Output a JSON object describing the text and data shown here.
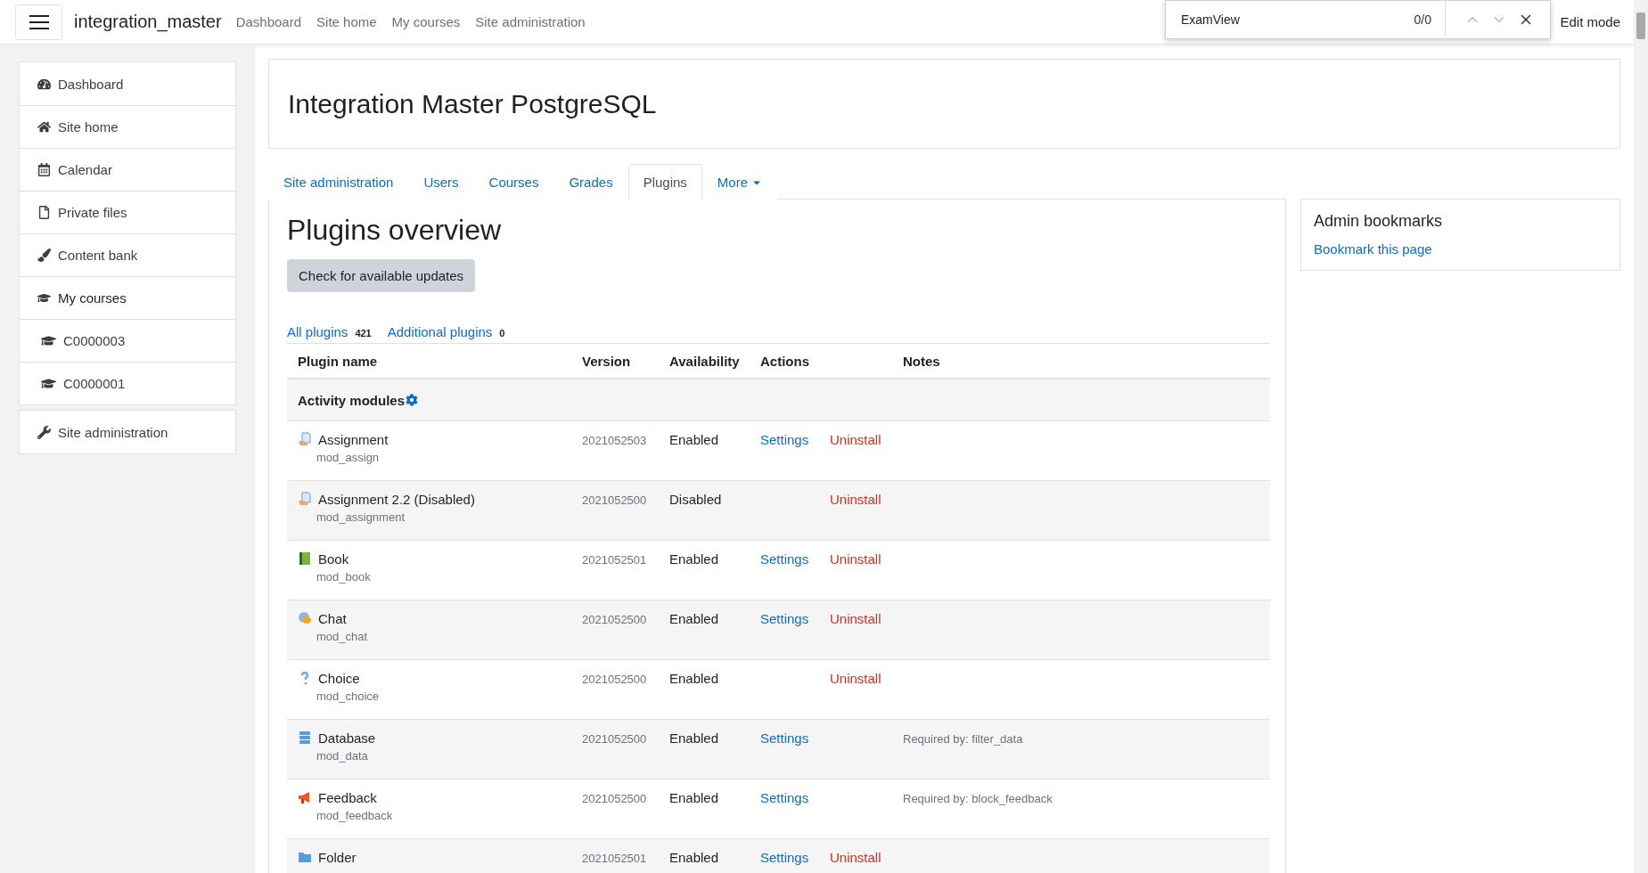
{
  "navbar": {
    "brand": "integration_master",
    "links": [
      "Dashboard",
      "Site home",
      "My courses",
      "Site administration"
    ],
    "edit_mode": "Edit mode"
  },
  "find_bar": {
    "value": "ExamView",
    "count": "0/0"
  },
  "sidebar": {
    "sections": [
      {
        "items": [
          {
            "label": "Dashboard"
          },
          {
            "label": "Site home"
          },
          {
            "label": "Calendar"
          },
          {
            "label": "Private files"
          },
          {
            "label": "Content bank"
          },
          {
            "label": "My courses",
            "children": [
              {
                "label": "C0000003"
              },
              {
                "label": "C0000001"
              }
            ]
          }
        ]
      },
      {
        "items": [
          {
            "label": "Site administration"
          }
        ]
      }
    ]
  },
  "header": {
    "title": "Integration Master PostgreSQL"
  },
  "tabs": [
    {
      "label": "Site administration",
      "selected": false,
      "kind": "link"
    },
    {
      "label": "Users",
      "selected": false,
      "kind": "link"
    },
    {
      "label": "Courses",
      "selected": false,
      "kind": "link"
    },
    {
      "label": "Grades",
      "selected": false,
      "kind": "link"
    },
    {
      "label": "Plugins",
      "selected": true,
      "kind": "link"
    },
    {
      "label": "More",
      "selected": false,
      "kind": "dropdown"
    }
  ],
  "content": {
    "title": "Plugins overview",
    "button": "Check for available updates",
    "filters": [
      {
        "label": "All plugins",
        "count": "421"
      },
      {
        "label": "Additional plugins",
        "count": "0"
      }
    ]
  },
  "table": {
    "columns": [
      "Plugin name",
      "Version",
      "Availability",
      "Actions",
      "Notes"
    ],
    "group": "Activity modules",
    "rows": [
      {
        "kind": "assign",
        "name": "Assignment",
        "module": "mod_assign",
        "version": "2021052503",
        "availability": "Enabled",
        "settings": "Settings",
        "uninstall": "Uninstall"
      },
      {
        "kind": "assign",
        "name": "Assignment 2.2 (Disabled)",
        "module": "mod_assignment",
        "version": "2021052500",
        "availability": "Disabled",
        "uninstall": "Uninstall"
      },
      {
        "kind": "book",
        "name": "Book",
        "module": "mod_book",
        "version": "2021052501",
        "availability": "Enabled",
        "settings": "Settings",
        "uninstall": "Uninstall"
      },
      {
        "kind": "chat",
        "name": "Chat",
        "module": "mod_chat",
        "version": "2021052500",
        "availability": "Enabled",
        "settings": "Settings",
        "uninstall": "Uninstall"
      },
      {
        "kind": "choice",
        "name": "Choice",
        "module": "mod_choice",
        "version": "2021052500",
        "availability": "Enabled",
        "uninstall": "Uninstall"
      },
      {
        "kind": "data",
        "name": "Database",
        "module": "mod_data",
        "version": "2021052500",
        "availability": "Enabled",
        "settings": "Settings",
        "notes": "Required by: filter_data"
      },
      {
        "kind": "feedback",
        "name": "Feedback",
        "module": "mod_feedback",
        "version": "2021052500",
        "availability": "Enabled",
        "settings": "Settings",
        "notes": "Required by: block_feedback"
      },
      {
        "kind": "folder",
        "name": "Folder",
        "version": "2021052501",
        "availability": "Enabled",
        "settings": "Settings",
        "uninstall": "Uninstall"
      }
    ]
  },
  "bookmarks": {
    "title": "Admin bookmarks",
    "link": "Bookmark this page"
  }
}
